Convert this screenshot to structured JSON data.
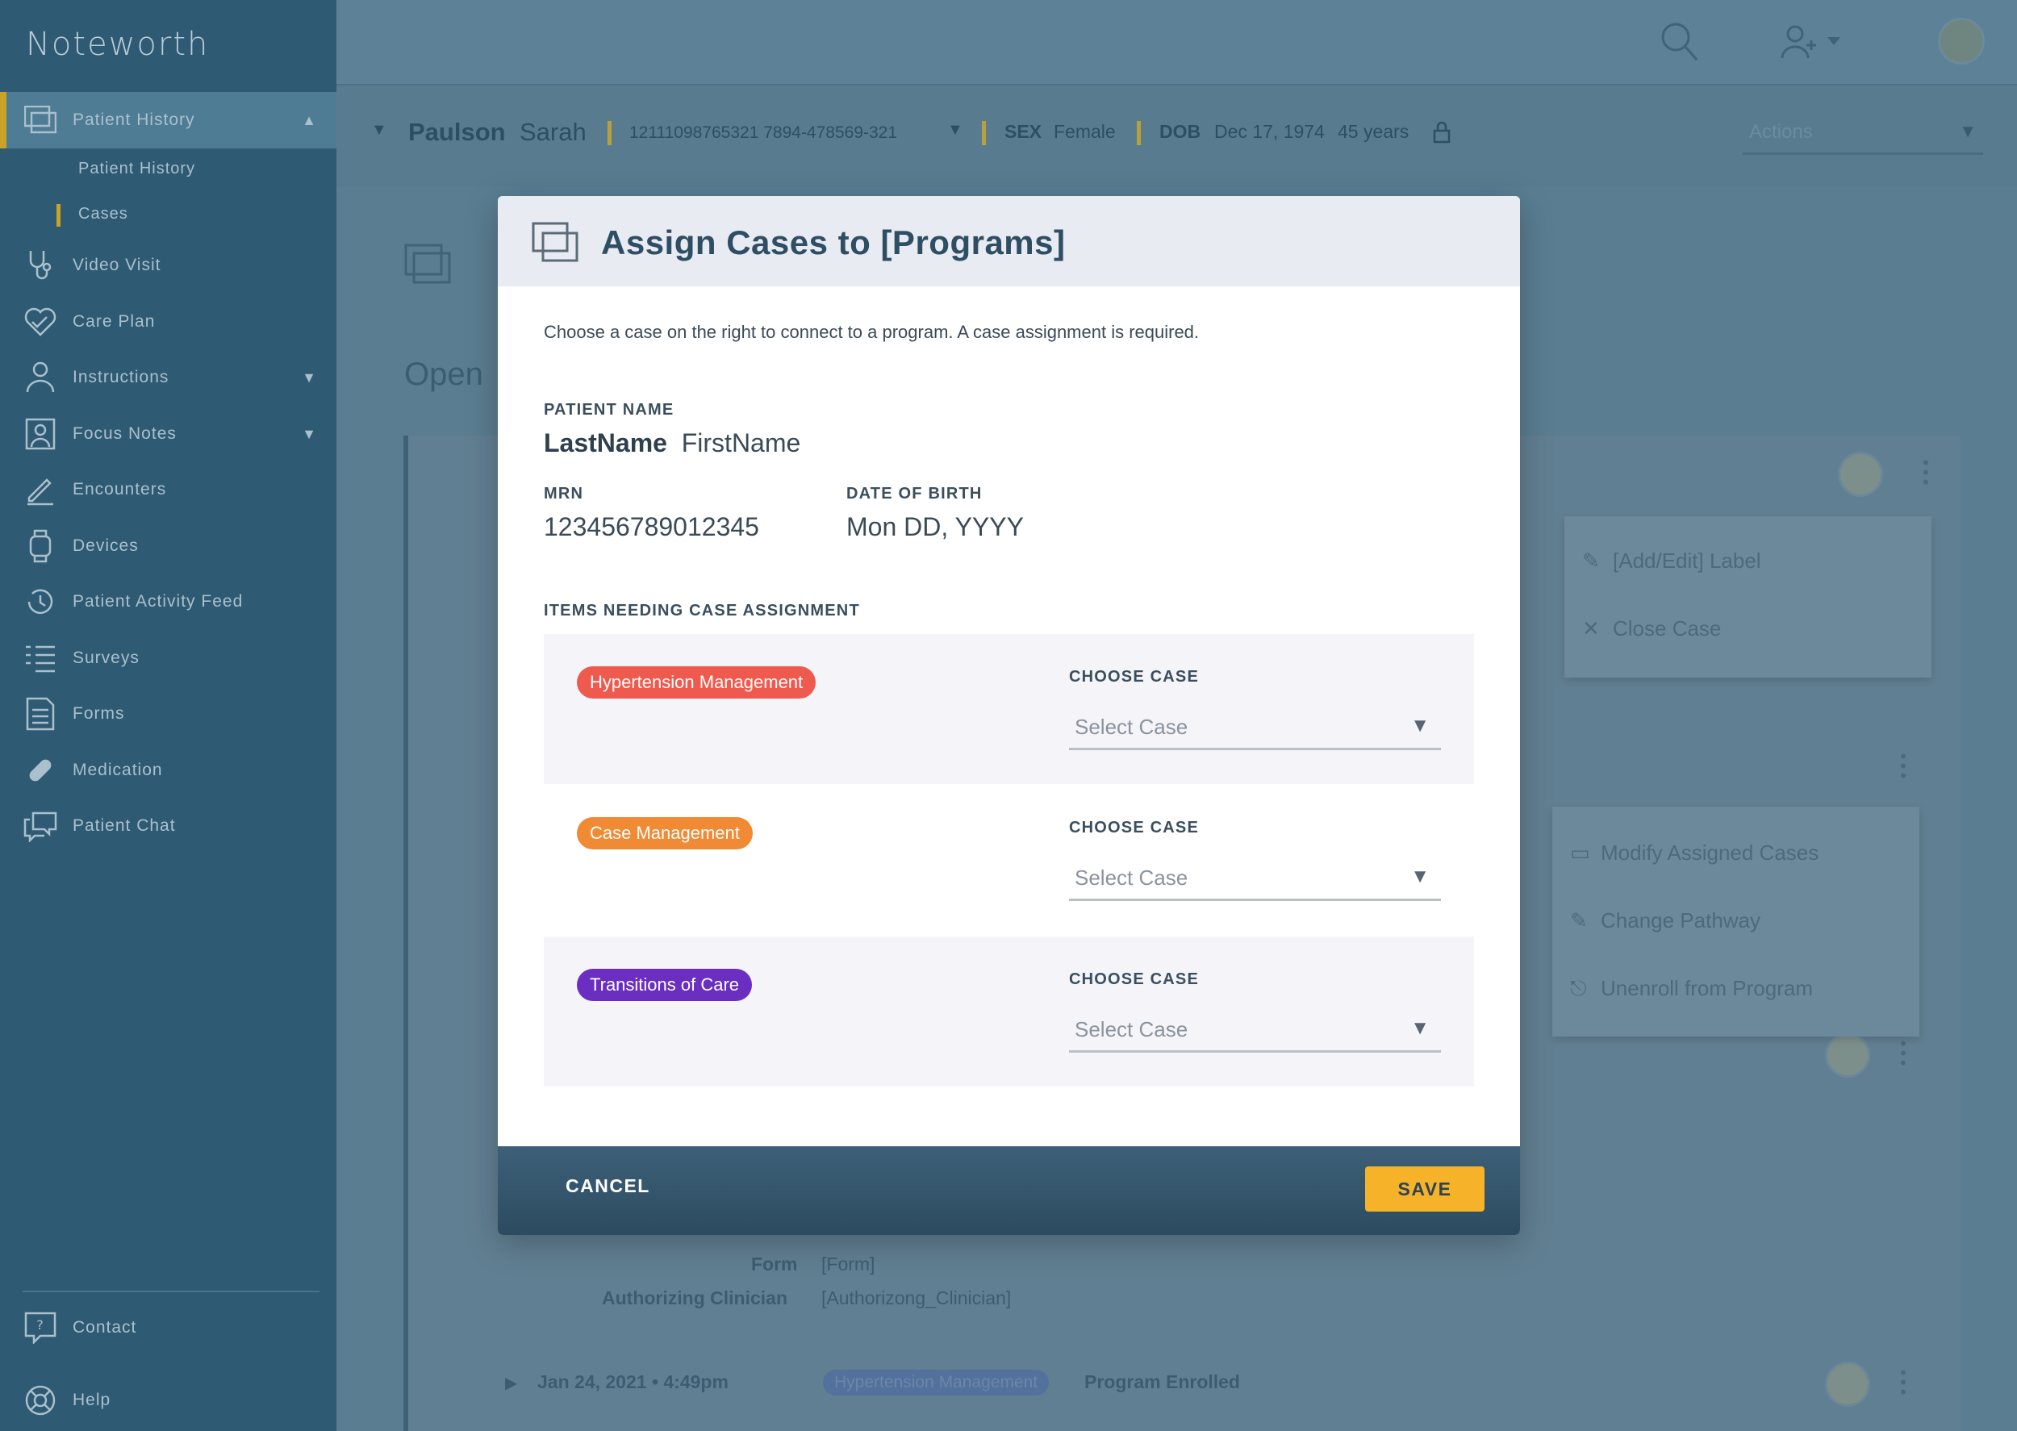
{
  "app": {
    "name": "Noteworth"
  },
  "sidebar": {
    "active_label": "Patient History",
    "sub_items": [
      "Patient History",
      "Cases"
    ],
    "items": [
      {
        "label": "Video Visit",
        "icon": "stethoscope-icon"
      },
      {
        "label": "Care Plan",
        "icon": "heart-icon"
      },
      {
        "label": "Instructions",
        "icon": "doctor-icon"
      },
      {
        "label": "Focus Notes",
        "icon": "profile-note-icon"
      },
      {
        "label": "Encounters",
        "icon": "pencil-icon"
      },
      {
        "label": "Devices",
        "icon": "watch-icon"
      },
      {
        "label": "Patient Activity Feed",
        "icon": "history-icon"
      },
      {
        "label": "Surveys",
        "icon": "checklist-icon"
      },
      {
        "label": "Forms",
        "icon": "form-icon"
      },
      {
        "label": "Medication",
        "icon": "pill-icon"
      },
      {
        "label": "Patient Chat",
        "icon": "chat-icon"
      }
    ],
    "bottom": [
      {
        "label": "Contact",
        "icon": "question-chat-icon"
      },
      {
        "label": "Help",
        "icon": "lifebuoy-icon"
      }
    ]
  },
  "patient_bar": {
    "last_name": "Paulson",
    "first_name": "Sarah",
    "ids": "12111098765321  7894-478569-321",
    "sex_label": "SEX",
    "sex": "Female",
    "dob_label": "DOB",
    "dob": "Dec 17, 1974",
    "age": "45 years",
    "actions": "Actions"
  },
  "background": {
    "section_open": "Open",
    "menu1": [
      "[Add/Edit] Label",
      "Close Case"
    ],
    "menu2": [
      "Modify Assigned Cases",
      "Change Pathway",
      "Unenroll from Program"
    ],
    "form_label": "Form",
    "form_value": "[Form]",
    "clinician_label": "Authorizing Clinician",
    "clinician_value": "[Authorizong_Clinician]",
    "timeline_date": "Jan 24, 2021 • 4:49pm",
    "timeline_tag": "Hypertension Management",
    "timeline_event": "Program Enrolled"
  },
  "modal": {
    "title": "Assign Cases to [Programs]",
    "description": "Choose a case on the right to connect to a program. A case assignment is required.",
    "patient_name_label": "PATIENT NAME",
    "last_name": "LastName",
    "first_name": "FirstName",
    "mrn_label": "MRN",
    "mrn": "123456789012345",
    "dob_label": "DATE OF BIRTH",
    "dob": "Mon DD, YYYY",
    "items_label": "ITEMS NEEDING CASE ASSIGNMENT",
    "rows": [
      {
        "program": "Hypertension Management",
        "color": "#ef5a4f",
        "choose_label": "CHOOSE CASE",
        "placeholder": "Select Case"
      },
      {
        "program": "Case Management",
        "color": "#f08a34",
        "choose_label": "CHOOSE CASE",
        "placeholder": "Select Case"
      },
      {
        "program": "Transitions of Care",
        "color": "#6a2ec0",
        "choose_label": "CHOOSE CASE",
        "placeholder": "Select Case"
      }
    ],
    "cancel": "CANCEL",
    "save": "SAVE"
  },
  "colors": {
    "sidebar": "#2f5a73",
    "save_button": "#f6b32a",
    "accent_bar": "#c9a227"
  }
}
